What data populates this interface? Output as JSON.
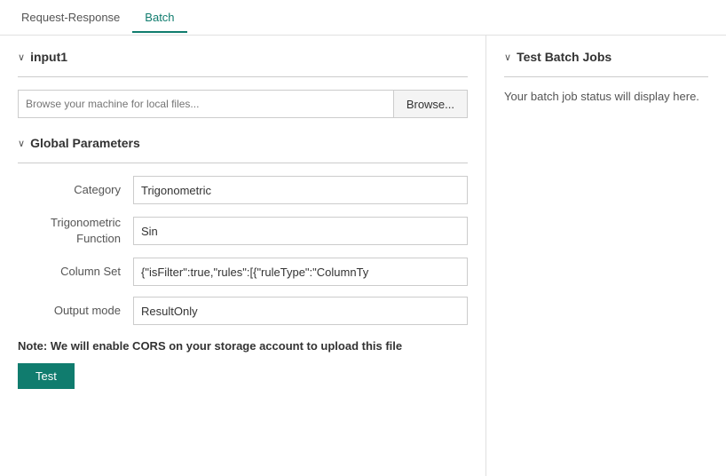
{
  "tabs": [
    {
      "id": "request-response",
      "label": "Request-Response",
      "active": false
    },
    {
      "id": "batch",
      "label": "Batch",
      "active": true
    }
  ],
  "left": {
    "input_section": {
      "title": "input1",
      "chevron": "∨",
      "file_input": {
        "placeholder": "Browse your machine for local files...",
        "browse_label": "Browse..."
      }
    },
    "global_params_section": {
      "title": "Global Parameters",
      "chevron": "∨",
      "params": [
        {
          "label": "Category",
          "value": "Trigonometric"
        },
        {
          "label": "Trigonometric\nFunction",
          "value": "Sin"
        },
        {
          "label": "Column Set",
          "value": "{\"isFilter\":true,\"rules\":[{\"ruleType\":\"ColumnTy"
        },
        {
          "label": "Output mode",
          "value": "ResultOnly"
        }
      ]
    },
    "cors_note": "Note: We will enable CORS on your storage account to upload this file",
    "test_button_label": "Test"
  },
  "right": {
    "batch_jobs_section": {
      "title": "Test Batch Jobs",
      "chevron": "∨",
      "status_text": "Your batch job status will display here."
    }
  }
}
